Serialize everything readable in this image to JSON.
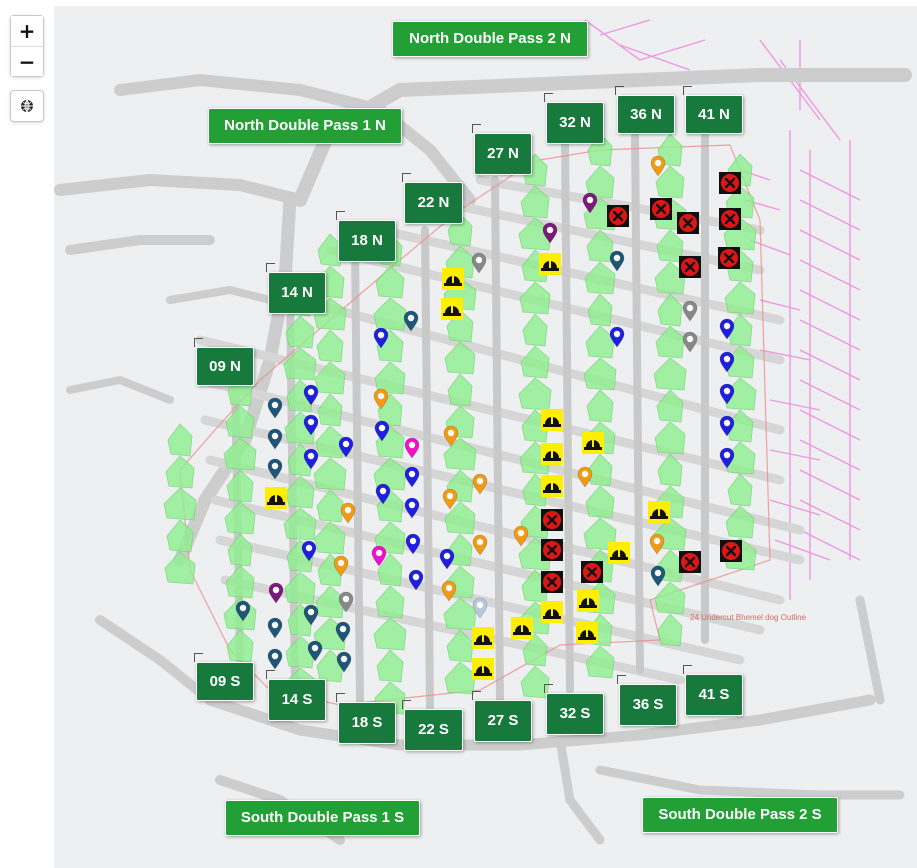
{
  "map_controls": {
    "zoom_in": "+",
    "zoom_out": "−",
    "layers_icon": "globe-icon"
  },
  "pass_labels": {
    "north_1": "North Double Pass 1 N",
    "north_2": "North Double Pass 2 N",
    "south_1": "South Double Pass 1 S",
    "south_2": "South Double Pass 2 S"
  },
  "drift_labels_north": [
    "09 N",
    "14 N",
    "18 N",
    "22 N",
    "27 N",
    "32 N",
    "36 N",
    "41 N"
  ],
  "drift_labels_south": [
    "09 S",
    "14 S",
    "18 S",
    "22 S",
    "27 S",
    "32 S",
    "36 S",
    "41 S"
  ],
  "map_text": {
    "annotation": "24 Undercut Bhemel dog Outline"
  },
  "colors": {
    "drift_label": "#177a3c",
    "pass_label": "#22a035",
    "green_cells": "#8fe88f",
    "road": "#cfcfcf",
    "pin_blue": "#1f1fe0",
    "pin_navy": "#1f5577",
    "pin_orange": "#f29a13",
    "pin_magenta": "#ee11cc",
    "pin_purple": "#7a1a7a",
    "pin_gray": "#888888",
    "pin_lightblue": "#b8c8dc",
    "closed_marker": "#e01616",
    "helmet_marker": "#ffee00"
  },
  "marker_types": {
    "pin": "location-pin-icon",
    "closed": "closed-x-icon",
    "helmet": "hard-hat-icon"
  }
}
